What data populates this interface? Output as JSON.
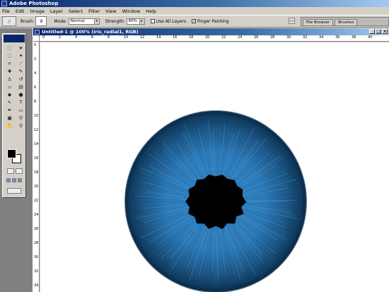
{
  "app": {
    "title": "Adobe Photoshop"
  },
  "menu": [
    "File",
    "Edit",
    "Image",
    "Layer",
    "Select",
    "Filter",
    "View",
    "Window",
    "Help"
  ],
  "options": {
    "brush_label": "Brush:",
    "brush_size": "9",
    "mode_label": "Mode:",
    "mode_value": "Normal",
    "strength_label": "Strength:",
    "strength_value": "60%",
    "use_all_layers_label": "Use All Layers",
    "use_all_layers_checked": false,
    "finger_painting_label": "Finger Painting",
    "finger_painting_checked": true
  },
  "palette_well": {
    "tabs": [
      "File Browser",
      "Brushes"
    ]
  },
  "document": {
    "title": "Untitled-1 @ 100% (iris_radial1, RGB)",
    "h_ruler": [
      "0",
      "2",
      "4",
      "6",
      "8",
      "10",
      "12",
      "14",
      "16",
      "18",
      "20",
      "22",
      "24",
      "26",
      "28",
      "30",
      "32",
      "34",
      "36",
      "38",
      "40"
    ],
    "v_ruler": [
      "0",
      "2",
      "4",
      "6",
      "8",
      "10",
      "12",
      "14",
      "16",
      "18",
      "20",
      "22",
      "24",
      "26",
      "28",
      "30",
      "32",
      "34"
    ]
  },
  "colors": {
    "title_bar": "#0a246a",
    "chrome": "#d4d0c8",
    "iris_outer": "#0a2f4f",
    "iris_mid": "#1f6aa8",
    "iris_light": "#4a9ad0",
    "pupil": "#000000"
  },
  "tools": [
    "rectangular-marquee-icon",
    "move-icon",
    "lasso-icon",
    "magic-wand-icon",
    "crop-icon",
    "slice-icon",
    "healing-brush-icon",
    "brush-icon",
    "clone-stamp-icon",
    "history-brush-icon",
    "eraser-icon",
    "gradient-icon",
    "blur-icon",
    "dodge-icon",
    "path-selection-icon",
    "type-icon",
    "pen-icon",
    "rectangle-shape-icon",
    "notes-icon",
    "eyedropper-icon",
    "hand-icon",
    "zoom-icon"
  ]
}
